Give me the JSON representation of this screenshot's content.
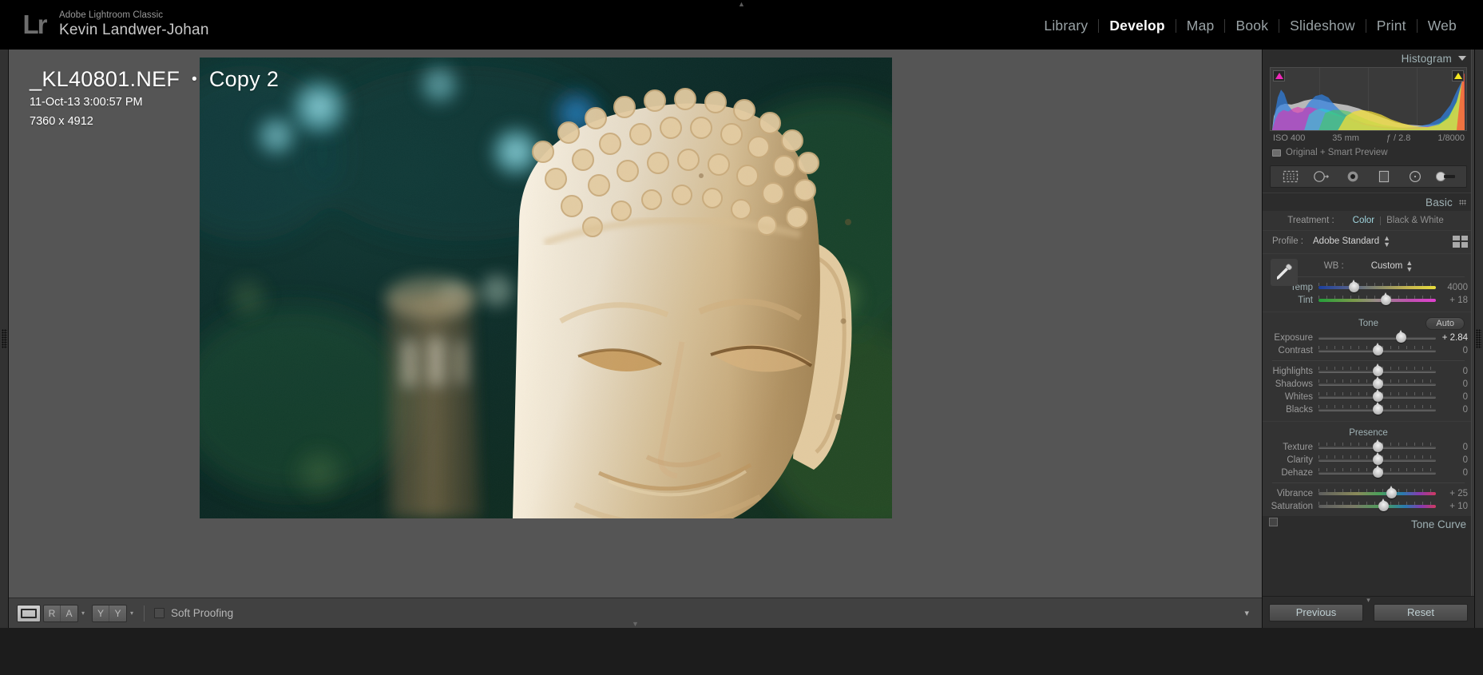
{
  "app": {
    "logo": "Lr",
    "name": "Adobe Lightroom Classic",
    "user": "Kevin Landwer-Johan",
    "collapse_glyph": "▲"
  },
  "modules": [
    {
      "label": "Library",
      "active": false
    },
    {
      "label": "Develop",
      "active": true
    },
    {
      "label": "Map",
      "active": false
    },
    {
      "label": "Book",
      "active": false
    },
    {
      "label": "Slideshow",
      "active": false
    },
    {
      "label": "Print",
      "active": false
    },
    {
      "label": "Web",
      "active": false
    }
  ],
  "photo_info": {
    "filename": "_KL40801.NEF",
    "separator": "•",
    "copy": "Copy 2",
    "capture_time": "11-Oct-13 3:00:57 PM",
    "dimensions": "7360 x 4912"
  },
  "histogram": {
    "title": "Histogram",
    "shadow_clip_color": "#ee29b8",
    "highlight_clip_color": "#f2e421",
    "exif": {
      "iso": "ISO 400",
      "focal_length": "35 mm",
      "aperture": "ƒ / 2.8",
      "shutter": "1/8000"
    },
    "smart_preview": "Original + Smart Preview"
  },
  "tools": [
    {
      "name": "crop-overlay-tool",
      "active": false
    },
    {
      "name": "spot-removal-tool",
      "active": false
    },
    {
      "name": "red-eye-correction-tool",
      "active": false
    },
    {
      "name": "graduated-filter-tool",
      "active": false
    },
    {
      "name": "radial-filter-tool",
      "active": false
    },
    {
      "name": "adjustment-brush-tool",
      "active": true
    }
  ],
  "basic": {
    "title": "Basic",
    "treatment": {
      "label": "Treatment :",
      "options": [
        "Color",
        "Black & White"
      ],
      "selected": "Color"
    },
    "profile": {
      "label": "Profile :",
      "value": "Adobe Standard"
    },
    "white_balance": {
      "label": "WB :",
      "value": "Custom",
      "sliders": [
        {
          "name": "Temp",
          "value": "4000",
          "pos": 30,
          "track": "temp",
          "highlight": true
        },
        {
          "name": "Tint",
          "value": "+ 18",
          "pos": 57,
          "track": "tint",
          "highlight": true
        }
      ]
    },
    "tone": {
      "label": "Tone",
      "auto_label": "Auto",
      "sliders": [
        {
          "name": "Exposure",
          "value": "+ 2.84",
          "pos": 70,
          "track": "plain",
          "active": true
        },
        {
          "name": "Contrast",
          "value": "0",
          "pos": 50,
          "track": "plain"
        },
        {
          "name": "Highlights",
          "value": "0",
          "pos": 50,
          "track": "plain"
        },
        {
          "name": "Shadows",
          "value": "0",
          "pos": 50,
          "track": "plain"
        },
        {
          "name": "Whites",
          "value": "0",
          "pos": 50,
          "track": "plain"
        },
        {
          "name": "Blacks",
          "value": "0",
          "pos": 50,
          "track": "plain"
        }
      ]
    },
    "presence": {
      "label": "Presence",
      "sliders": [
        {
          "name": "Texture",
          "value": "0",
          "pos": 50,
          "track": "plain"
        },
        {
          "name": "Clarity",
          "value": "0",
          "pos": 50,
          "track": "plain"
        },
        {
          "name": "Dehaze",
          "value": "0",
          "pos": 50,
          "track": "plain"
        },
        {
          "name": "Vibrance",
          "value": "+ 25",
          "pos": 62,
          "track": "vib"
        },
        {
          "name": "Saturation",
          "value": "+ 10",
          "pos": 55,
          "track": "sat"
        }
      ]
    }
  },
  "tone_curve": {
    "title": "Tone Curve"
  },
  "panel_buttons": {
    "previous": "Previous",
    "reset": "Reset"
  },
  "toolbar": {
    "loupe_view": "loupe-view",
    "before_after": [
      "R",
      "A"
    ],
    "compare": [
      "Y",
      "Y"
    ],
    "soft_proofing_label": "Soft Proofing",
    "soft_proofing_checked": false,
    "caret": "▾"
  }
}
